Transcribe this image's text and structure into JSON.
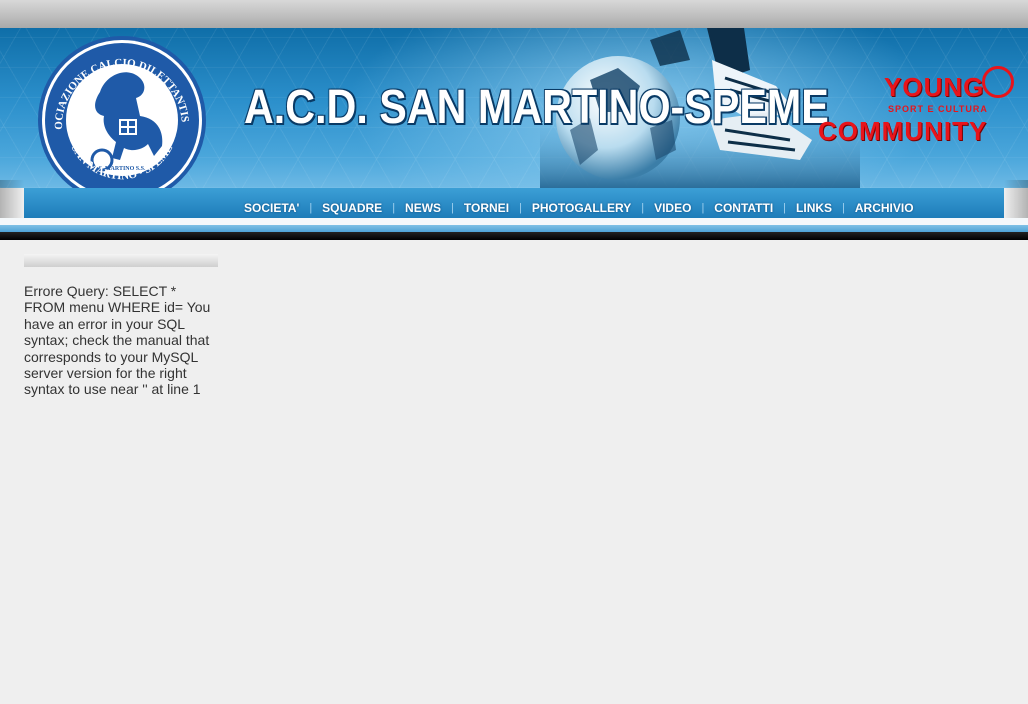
{
  "header": {
    "title": "A.C.D. SAN MARTINO-SPEME",
    "logo": {
      "ring_text": "ASSOCIAZIONE CALCIO DILETTANTISTICA",
      "bottom_text": "SAN MARTINO • SPEME",
      "inner_text": "S. MARTINO S.S."
    },
    "sponsor": {
      "young": "YOUNG",
      "subtitle": "SPORT E CULTURA",
      "community": "COMMUNITY"
    }
  },
  "nav": {
    "items": [
      "SOCIETA'",
      "SQUADRE",
      "NEWS",
      "TORNEI",
      "PHOTOGALLERY",
      "VIDEO",
      "CONTATTI",
      "LINKS",
      "ARCHIVIO"
    ]
  },
  "content": {
    "error_message": "Errore Query: SELECT * FROM menu WHERE id= You have an error in your SQL syntax; check the manual that corresponds to your MySQL server version for the right syntax to use near '' at line 1"
  },
  "colors": {
    "banner_blue": "#2b8fcb",
    "sponsor_red": "#e8141b",
    "page_bg": "#efefef"
  }
}
